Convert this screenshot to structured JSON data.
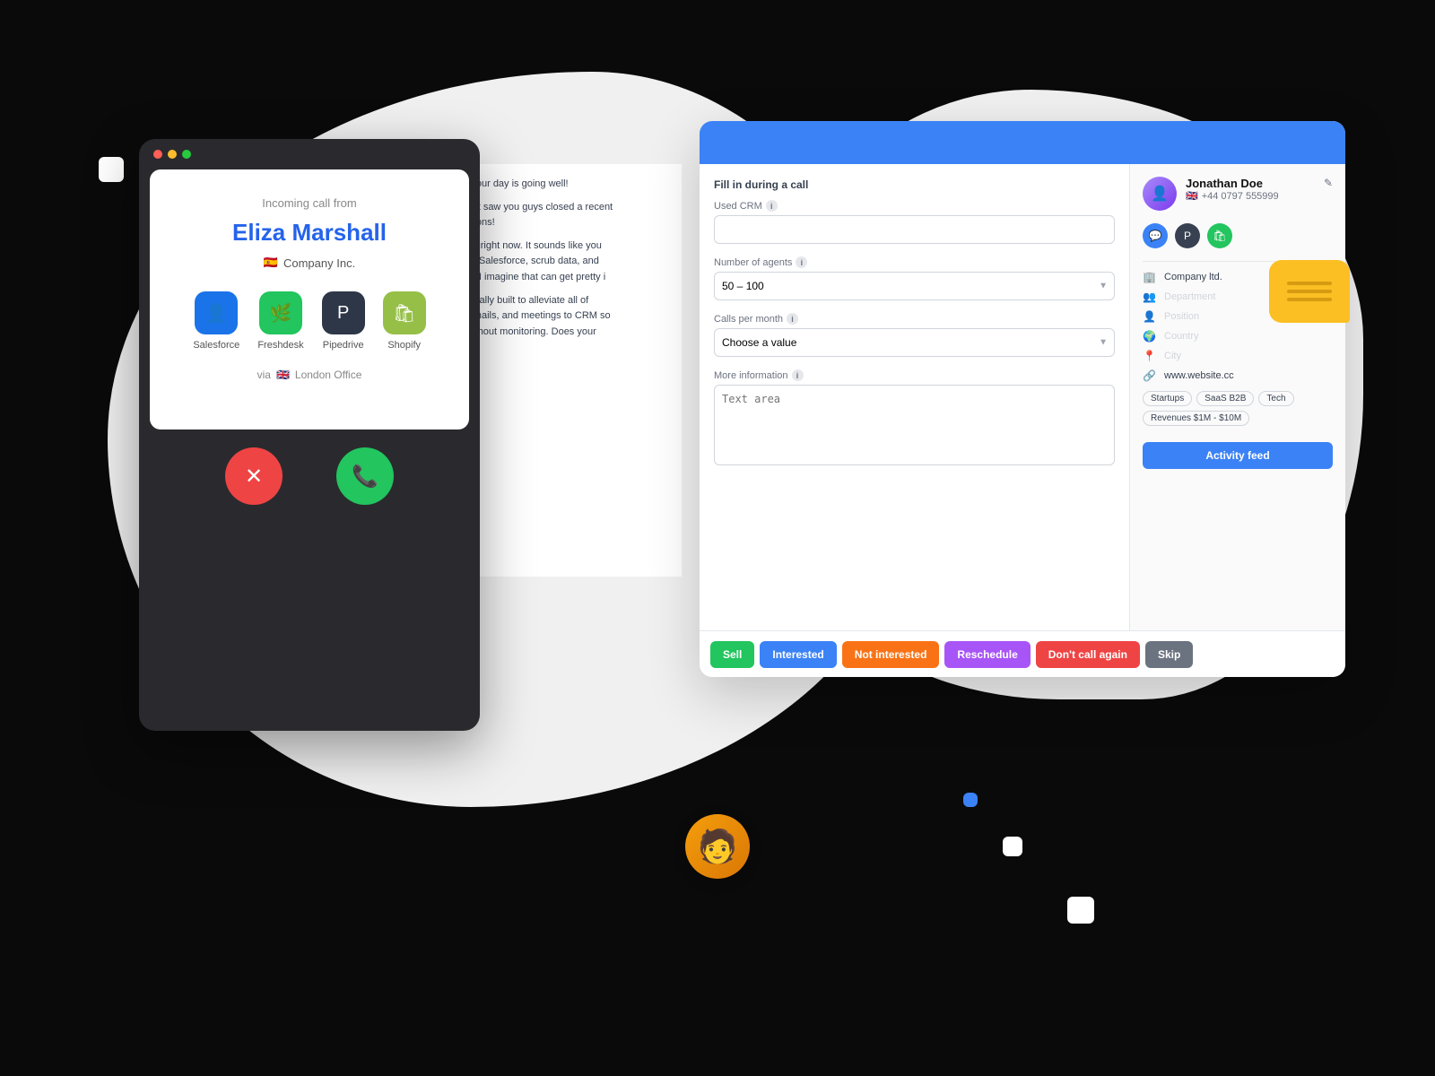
{
  "scene": {
    "background": "#0a0a0a"
  },
  "phone": {
    "incoming_label": "Incoming call from",
    "caller_name": "Eliza Marshall",
    "company": "Company Inc.",
    "flag": "🇪🇸",
    "via_text": "via",
    "via_flag": "🇬🇧",
    "via_location": "London Office",
    "integrations": [
      {
        "name": "Salesforce",
        "icon": "👤",
        "color": "#1a73e8"
      },
      {
        "name": "Freshdesk",
        "icon": "🌿",
        "color": "#22c55e"
      },
      {
        "name": "Pipedrive",
        "icon": "P",
        "color": "#2d3748"
      },
      {
        "name": "Shopify",
        "icon": "🛍",
        "color": "#96bf48"
      }
    ],
    "btn_decline": "✕",
    "btn_accept": "📞"
  },
  "crm": {
    "fill_in_label": "Fill in during a call",
    "fields": {
      "used_crm": {
        "label": "Used CRM",
        "value": ""
      },
      "number_of_agents": {
        "label": "Number of agents",
        "value": "50 – 100"
      },
      "calls_per_month": {
        "label": "Calls per month",
        "placeholder": "Choose a value"
      },
      "more_information": {
        "label": "More information",
        "placeholder": "Text area"
      }
    },
    "contact": {
      "name": "Jonathan Doe",
      "phone": "+44 0797 555999",
      "flag": "🇬🇧",
      "company": "Company ltd.",
      "department": "Department",
      "position": "Position",
      "country": "Country",
      "city": "City",
      "website": "www.website.cc",
      "tags": [
        "Startups",
        "SaaS B2B",
        "Tech",
        "Revenues $1M - $10M"
      ]
    },
    "activity_btn": "Activity feed",
    "footer_buttons": [
      {
        "label": "Sell",
        "class": "btn-sell"
      },
      {
        "label": "Interested",
        "class": "btn-interested"
      },
      {
        "label": "Not interested",
        "class": "btn-not-interested"
      },
      {
        "label": "Reschedule",
        "class": "btn-reschedule"
      },
      {
        "label": "Don't call again",
        "class": "btn-dont-call"
      },
      {
        "label": "Skip",
        "class": "btn-skip"
      }
    ]
  },
  "chat_messages": [
    "ere. Hope your day is going well!",
    "ile, and I just saw you guys closed a recent\ncongratulations!",
    "les Ops role right now. It sounds like you\nctivities into Salesforce, scrub data, and\ng new reps. I imagine that can get pretty i",
    "alk was actually built to alleviate all of\nlike calls, emails, and meetings to CRM so\naccurate without monitoring. Does your\nent tools?"
  ],
  "choose_label": "Choose"
}
